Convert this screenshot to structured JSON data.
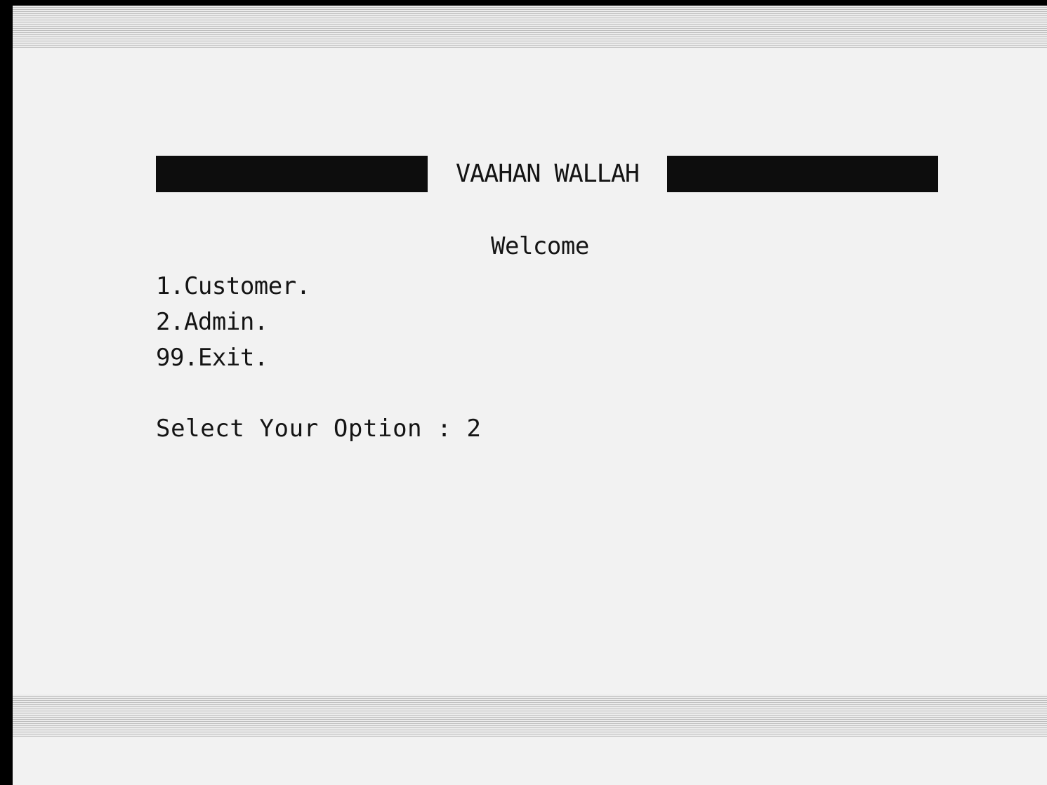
{
  "console": {
    "title": "VAAHAN WALLAH",
    "welcome": "Welcome",
    "menu": [
      {
        "label": "1.Customer."
      },
      {
        "label": "2.Admin."
      },
      {
        "label": "99.Exit."
      }
    ],
    "prompt": {
      "label": "Select Your Option : ",
      "value": "2"
    }
  },
  "colors": {
    "background": "#f2f2f2",
    "text": "#141414",
    "title_bar": "#0d0d0d",
    "frame": "#000000"
  }
}
